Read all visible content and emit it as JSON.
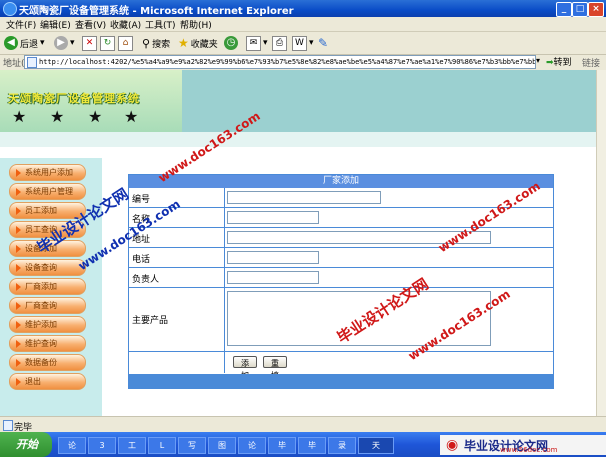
{
  "window": {
    "title": "天颂陶瓷厂设备管理系统 - Microsoft Internet Explorer",
    "controls": [
      "_",
      "□",
      "×"
    ]
  },
  "menu": [
    "文件(F)",
    "编辑(E)",
    "查看(V)",
    "收藏(A)",
    "工具(T)",
    "帮助(H)"
  ],
  "toolbar": {
    "back_label": "后退",
    "search_label": "搜索",
    "favorites_label": "收藏夹"
  },
  "address": {
    "label": "地址(D)",
    "url": "http://localhost:4202/%e5%a4%a9%e9%a2%82%e9%99%b6%e7%93%b7%e5%8e%82%e8%ae%be%e5%a4%87%e7%ae%a1%e7%90%86%e7%b3%bb%e7%bb%9f/main.aspx",
    "go_label": "转到",
    "links_label": "链接"
  },
  "banner": {
    "title": "天颂陶瓷厂设备管理系统"
  },
  "nav": [
    "系统用户添加",
    "系统用户管理",
    "员工添加",
    "员工查询",
    "设备添加",
    "设备查询",
    "厂商添加",
    "厂商查询",
    "维护添加",
    "维护查询",
    "数据备份",
    "退出"
  ],
  "form": {
    "heading": "厂家添加",
    "fields": [
      {
        "label": "编号",
        "value": ""
      },
      {
        "label": "名称",
        "value": ""
      },
      {
        "label": "地址",
        "value": ""
      },
      {
        "label": "电话",
        "value": ""
      },
      {
        "label": "负责人",
        "value": ""
      },
      {
        "label": "主要产品",
        "value": ""
      }
    ],
    "submit_label": "添加",
    "reset_label": "重填"
  },
  "status": {
    "text": "完毕"
  },
  "taskbar": {
    "start_label": "开始",
    "tasks": [
      "论",
      "3",
      "工",
      "L",
      "写",
      "图",
      "论",
      "毕",
      "毕",
      "录",
      "天"
    ]
  },
  "watermarks": {
    "site": "www.doc163.com",
    "brand": "毕业设计论文网",
    "bottom_site": "www.56doc.com"
  }
}
